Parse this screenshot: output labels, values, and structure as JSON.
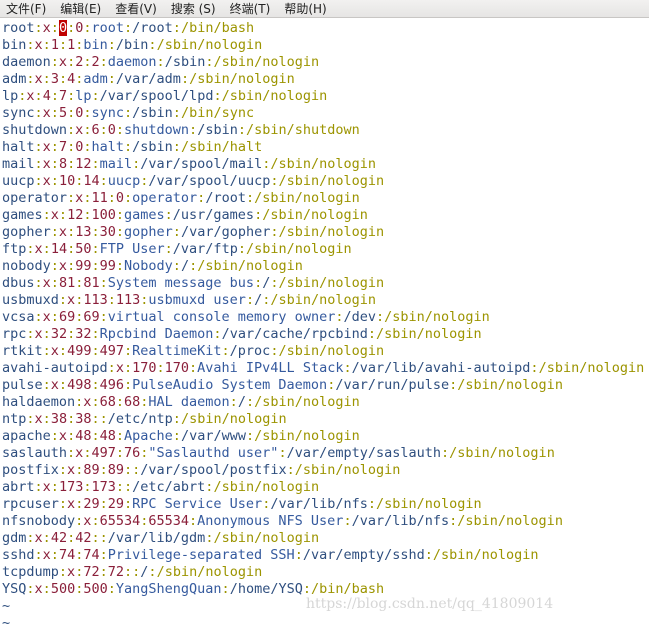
{
  "menu": [
    {
      "label": "文件(F)"
    },
    {
      "label": "编辑(E)"
    },
    {
      "label": "查看(V)"
    },
    {
      "label": "搜索 (S)"
    },
    {
      "label": "终端(T)"
    },
    {
      "label": "帮助(H)"
    }
  ],
  "cursor_line": 0,
  "lines": [
    {
      "user": "root",
      "pw": "x",
      "uid": "0",
      "gid": "0",
      "gecos": "root",
      "home": "/root",
      "shell": "/bin/bash"
    },
    {
      "user": "bin",
      "pw": "x",
      "uid": "1",
      "gid": "1",
      "gecos": "bin",
      "home": "/bin",
      "shell": "/sbin/nologin"
    },
    {
      "user": "daemon",
      "pw": "x",
      "uid": "2",
      "gid": "2",
      "gecos": "daemon",
      "home": "/sbin",
      "shell": "/sbin/nologin"
    },
    {
      "user": "adm",
      "pw": "x",
      "uid": "3",
      "gid": "4",
      "gecos": "adm",
      "home": "/var/adm",
      "shell": "/sbin/nologin"
    },
    {
      "user": "lp",
      "pw": "x",
      "uid": "4",
      "gid": "7",
      "gecos": "lp",
      "home": "/var/spool/lpd",
      "shell": "/sbin/nologin"
    },
    {
      "user": "sync",
      "pw": "x",
      "uid": "5",
      "gid": "0",
      "gecos": "sync",
      "home": "/sbin",
      "shell": "/bin/sync"
    },
    {
      "user": "shutdown",
      "pw": "x",
      "uid": "6",
      "gid": "0",
      "gecos": "shutdown",
      "home": "/sbin",
      "shell": "/sbin/shutdown"
    },
    {
      "user": "halt",
      "pw": "x",
      "uid": "7",
      "gid": "0",
      "gecos": "halt",
      "home": "/sbin",
      "shell": "/sbin/halt"
    },
    {
      "user": "mail",
      "pw": "x",
      "uid": "8",
      "gid": "12",
      "gecos": "mail",
      "home": "/var/spool/mail",
      "shell": "/sbin/nologin"
    },
    {
      "user": "uucp",
      "pw": "x",
      "uid": "10",
      "gid": "14",
      "gecos": "uucp",
      "home": "/var/spool/uucp",
      "shell": "/sbin/nologin"
    },
    {
      "user": "operator",
      "pw": "x",
      "uid": "11",
      "gid": "0",
      "gecos": "operator",
      "home": "/root",
      "shell": "/sbin/nologin"
    },
    {
      "user": "games",
      "pw": "x",
      "uid": "12",
      "gid": "100",
      "gecos": "games",
      "home": "/usr/games",
      "shell": "/sbin/nologin"
    },
    {
      "user": "gopher",
      "pw": "x",
      "uid": "13",
      "gid": "30",
      "gecos": "gopher",
      "home": "/var/gopher",
      "shell": "/sbin/nologin"
    },
    {
      "user": "ftp",
      "pw": "x",
      "uid": "14",
      "gid": "50",
      "gecos": "FTP User",
      "home": "/var/ftp",
      "shell": "/sbin/nologin"
    },
    {
      "user": "nobody",
      "pw": "x",
      "uid": "99",
      "gid": "99",
      "gecos": "Nobody",
      "home": "/",
      "shell": "/sbin/nologin"
    },
    {
      "user": "dbus",
      "pw": "x",
      "uid": "81",
      "gid": "81",
      "gecos": "System message bus",
      "home": "/",
      "shell": "/sbin/nologin"
    },
    {
      "user": "usbmuxd",
      "pw": "x",
      "uid": "113",
      "gid": "113",
      "gecos": "usbmuxd user",
      "home": "/",
      "shell": "/sbin/nologin"
    },
    {
      "user": "vcsa",
      "pw": "x",
      "uid": "69",
      "gid": "69",
      "gecos": "virtual console memory owner",
      "home": "/dev",
      "shell": "/sbin/nologin"
    },
    {
      "user": "rpc",
      "pw": "x",
      "uid": "32",
      "gid": "32",
      "gecos": "Rpcbind Daemon",
      "home": "/var/cache/rpcbind",
      "shell": "/sbin/nologin"
    },
    {
      "user": "rtkit",
      "pw": "x",
      "uid": "499",
      "gid": "497",
      "gecos": "RealtimeKit",
      "home": "/proc",
      "shell": "/sbin/nologin"
    },
    {
      "user": "avahi-autoipd",
      "pw": "x",
      "uid": "170",
      "gid": "170",
      "gecos": "Avahi IPv4LL Stack",
      "home": "/var/lib/avahi-autoipd",
      "shell": "/sbin/nologin"
    },
    {
      "user": "pulse",
      "pw": "x",
      "uid": "498",
      "gid": "496",
      "gecos": "PulseAudio System Daemon",
      "home": "/var/run/pulse",
      "shell": "/sbin/nologin"
    },
    {
      "user": "haldaemon",
      "pw": "x",
      "uid": "68",
      "gid": "68",
      "gecos": "HAL daemon",
      "home": "/",
      "shell": "/sbin/nologin"
    },
    {
      "user": "ntp",
      "pw": "x",
      "uid": "38",
      "gid": "38",
      "gecos": "",
      "home": "/etc/ntp",
      "shell": "/sbin/nologin"
    },
    {
      "user": "apache",
      "pw": "x",
      "uid": "48",
      "gid": "48",
      "gecos": "Apache",
      "home": "/var/www",
      "shell": "/sbin/nologin"
    },
    {
      "user": "saslauth",
      "pw": "x",
      "uid": "497",
      "gid": "76",
      "gecos": "\"Saslauthd user\"",
      "home": "/var/empty/saslauth",
      "shell": "/sbin/nologin"
    },
    {
      "user": "postfix",
      "pw": "x",
      "uid": "89",
      "gid": "89",
      "gecos": "",
      "home": "/var/spool/postfix",
      "shell": "/sbin/nologin"
    },
    {
      "user": "abrt",
      "pw": "x",
      "uid": "173",
      "gid": "173",
      "gecos": "",
      "home": "/etc/abrt",
      "shell": "/sbin/nologin"
    },
    {
      "user": "rpcuser",
      "pw": "x",
      "uid": "29",
      "gid": "29",
      "gecos": "RPC Service User",
      "home": "/var/lib/nfs",
      "shell": "/sbin/nologin"
    },
    {
      "user": "nfsnobody",
      "pw": "x",
      "uid": "65534",
      "gid": "65534",
      "gecos": "Anonymous NFS User",
      "home": "/var/lib/nfs",
      "shell": "/sbin/nologin"
    },
    {
      "user": "gdm",
      "pw": "x",
      "uid": "42",
      "gid": "42",
      "gecos": "",
      "home": "/var/lib/gdm",
      "shell": "/sbin/nologin"
    },
    {
      "user": "sshd",
      "pw": "x",
      "uid": "74",
      "gid": "74",
      "gecos": "Privilege-separated SSH",
      "home": "/var/empty/sshd",
      "shell": "/sbin/nologin"
    },
    {
      "user": "tcpdump",
      "pw": "x",
      "uid": "72",
      "gid": "72",
      "gecos": "",
      "home": "/",
      "shell": "/sbin/nologin"
    },
    {
      "user": "YSQ",
      "pw": "x",
      "uid": "500",
      "gid": "500",
      "gecos": "YangShengQuan",
      "home": "/home/YSQ",
      "shell": "/bin/bash"
    }
  ],
  "tildes": [
    "~",
    "~"
  ],
  "watermark": "https://blog.csdn.net/qq_41809014"
}
